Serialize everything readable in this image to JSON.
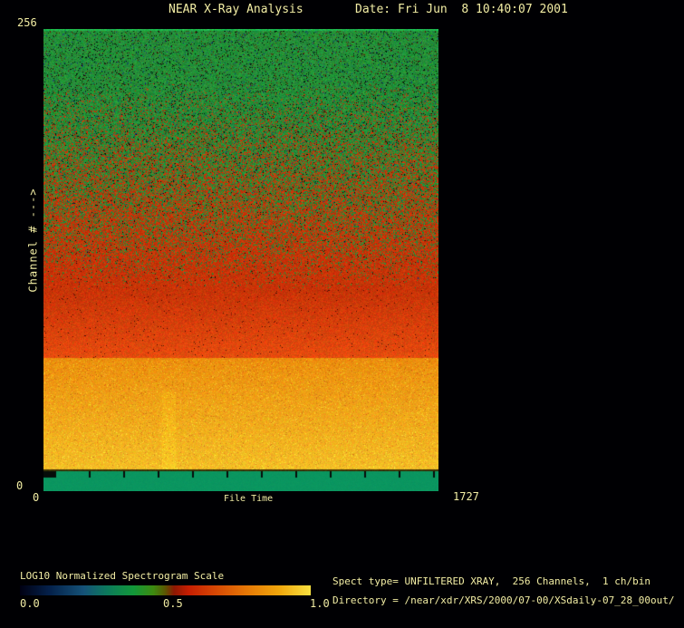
{
  "colors": {
    "background": "#000003",
    "text": "#f2eda4"
  },
  "header": {
    "title": "NEAR X-Ray Analysis",
    "date": "Date: Fri Jun  8 10:40:07 2001"
  },
  "plot": {
    "y_max": "256",
    "y_min": "0",
    "y_label": "Channel # --->",
    "x_min": "0",
    "x_max": "1727",
    "x_label": "File Time"
  },
  "colorbar": {
    "title": "LOG10 Normalized Spectrogram Scale",
    "tick_labels": [
      "0.0",
      "0.5",
      "1.0"
    ],
    "gradient_stops": [
      "#000012 0%",
      "#04204a 10%",
      "#155278 22%",
      "#0c7a5c 30%",
      "#12983a 39%",
      "#3e8a10 46%",
      "#5c5602 50%",
      "#8c1802 53%",
      "#c61e02 58%",
      "#d44204 66%",
      "#e67806 78%",
      "#f0a60c 89%",
      "#f8e040 100%"
    ]
  },
  "info": {
    "spect_type": "Spect type= UNFILTERED XRAY,  256 Channels,  1 ch/bin",
    "directory": "Directory = /near/xdr/XRS/2000/07-00/XSdaily-07_28_00out/"
  },
  "chart_data": {
    "type": "heatmap",
    "title": "NEAR X-Ray Analysis",
    "xlabel": "File Time",
    "ylabel": "Channel #",
    "xlim": [
      0,
      1727
    ],
    "ylim": [
      0,
      256
    ],
    "grid": false,
    "colorbar_label": "LOG10 Normalized Spectrogram Scale",
    "colorbar_ticks": [
      0.0,
      0.5,
      1.0
    ],
    "colorbar_position": "bottom-left",
    "bands": [
      {
        "kind": "topline",
        "channels": [
          255,
          256
        ],
        "color": "#1eb24c",
        "value": 0.42,
        "desc": "thin bright green line at top edge"
      },
      {
        "kind": "mix",
        "channels": [
          74,
          255
        ],
        "green": "#248e38",
        "red": "#c83408",
        "value_top": 0.42,
        "value_bottom": 0.62,
        "desc": "noisy green at high channels blending gradually into red below ~channel 170, fully red by ~channel 110"
      },
      {
        "kind": "orange",
        "channels": [
          12,
          74
        ],
        "color_top": "#ec8f0e",
        "color_bottom": "#f4be26",
        "value": 0.85,
        "desc": "bright orange-yellow high-intensity band, more yellow toward low channels"
      },
      {
        "kind": "line",
        "channels": [
          11,
          12
        ],
        "color": "#3a3206",
        "value": 0.5,
        "desc": "thin dark separator line"
      },
      {
        "kind": "solid",
        "channels": [
          0,
          11
        ],
        "color": "#0b9660",
        "value": 0.38,
        "ticks": true,
        "desc": "uniform teal-green band with small black time tick marks at its top"
      }
    ]
  }
}
